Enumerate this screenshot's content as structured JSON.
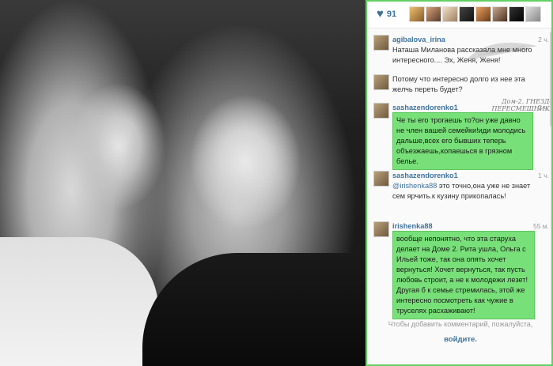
{
  "likes": {
    "count": "91"
  },
  "likers": [
    "liker-1",
    "liker-2",
    "liker-3",
    "liker-4",
    "liker-5",
    "liker-6",
    "liker-7",
    "liker-8"
  ],
  "comments": [
    {
      "username": "agibalova_irina",
      "time": "2 ч.",
      "text": "Наташа Миланова рассказала мне много интересного.... Эх, Женя, Женя!"
    },
    {
      "username": "",
      "time": "",
      "text": "Потому что интересно долго из нее эта желчь переть будет?"
    },
    {
      "username": "sashazendorenko1",
      "time": "2 ч.",
      "text": "Че ты его трогаешь то?он уже давно не член вашей семейки!иди молодись дальше,всех его бывших теперь объезжаешь,копаешься в грязном белье."
    },
    {
      "username": "sashazendorenko1",
      "time": "1 ч.",
      "mention": "@irishenka88",
      "text": " это точно,она уже не знает сем ярчить.к кузину прикопалась!"
    },
    {
      "username": "irishenka88",
      "time": "55 м.",
      "text": "вообще непонятно, что эта старуха делает на Доме 2. Рита ушла, Ольга с Ильей тоже, так она опять хочет вернуться! Хочет вернуться, так пусть любовь строит, а не к молодежи лезет! Другая б к семье стремилась, этой же интересно посмотреть как чужие в труселях расхаживают!"
    }
  ],
  "watermark": "Дом-2. ГНЕЗДО ПЕРЕСМЕШНИКА",
  "footer": {
    "prompt": "Чтобы добавить комментарий, пожалуйста,",
    "login": "войдите."
  },
  "colors": {
    "accent": "#3f729b",
    "highlight": "#78e078"
  }
}
